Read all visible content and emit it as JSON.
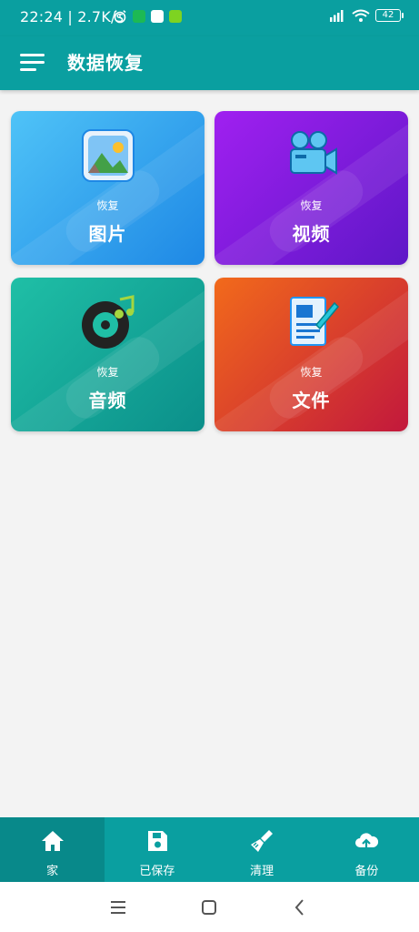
{
  "status_bar": {
    "time": "22:24 | 2.7K/s",
    "battery": "42"
  },
  "app_bar": {
    "title": "数据恢复"
  },
  "cards": [
    {
      "sub": "恢复",
      "title": "图片",
      "icon": "image-icon",
      "colors": [
        "#4fc3f7",
        "#1e88e5"
      ]
    },
    {
      "sub": "恢复",
      "title": "视频",
      "icon": "video-camera-icon",
      "colors": [
        "#a020f0",
        "#5e17c7"
      ]
    },
    {
      "sub": "恢复",
      "title": "音频",
      "icon": "music-disc-icon",
      "colors": [
        "#1fbfa6",
        "#0b8f8a"
      ]
    },
    {
      "sub": "恢复",
      "title": "文件",
      "icon": "document-icon",
      "colors": [
        "#f26a1b",
        "#c2183c"
      ]
    }
  ],
  "bottom_nav": [
    {
      "label": "家",
      "icon": "home-icon",
      "active": true
    },
    {
      "label": "已保存",
      "icon": "save-icon",
      "active": false
    },
    {
      "label": "清理",
      "icon": "broom-icon",
      "active": false
    },
    {
      "label": "备份",
      "icon": "cloud-upload-icon",
      "active": false
    }
  ],
  "colors": {
    "primary": "#0a9fa0",
    "primary_dark": "#08898a",
    "background": "#f3f3f3"
  }
}
